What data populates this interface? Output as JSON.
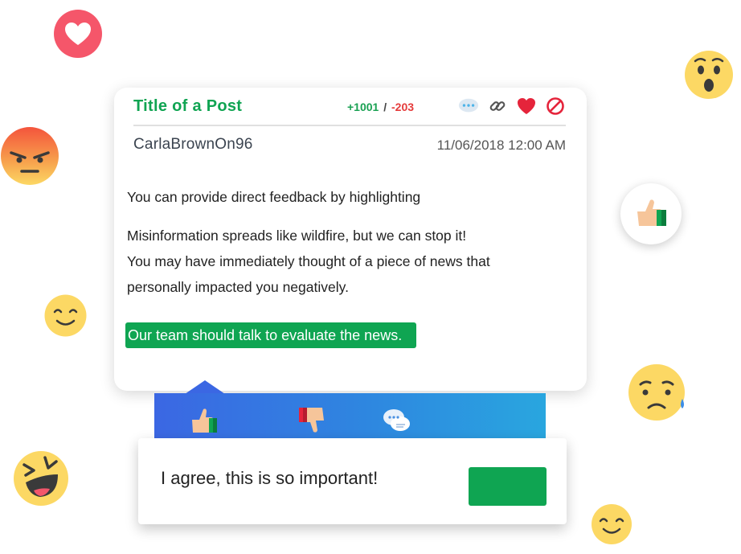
{
  "post": {
    "title": "Title of a Post",
    "votes_up": "+1001",
    "votes_separator": "/",
    "votes_down": "-203",
    "author": "CarlaBrownOn96",
    "timestamp": "11/06/2018 12:00 AM",
    "paragraph_1": "You can provide direct feedback by highlighting",
    "paragraph_2_line_1": "Misinformation spreads like wildfire, but we can stop it!",
    "paragraph_2_line_2": "You may have immediately thought of a piece of news that",
    "paragraph_2_line_3": "personally impacted you negatively.",
    "highlighted_text": "Our team should talk to evaluate the news.",
    "actions": [
      "comment-bubble-icon",
      "link-icon",
      "heart-icon",
      "block-icon"
    ]
  },
  "reaction_bar": {
    "buttons": [
      "thumbs-up-icon",
      "thumbs-down-icon",
      "chat-bubbles-icon"
    ]
  },
  "comment": {
    "value": "I agree, this is so important!",
    "submit_label": ""
  },
  "decorations": {
    "emojis": [
      "heart-emoji",
      "surprised-emoji",
      "angry-emoji",
      "smile-emoji",
      "sad-tear-emoji",
      "laughing-emoji",
      "smile-emoji"
    ],
    "floating_reaction": "thumbs-up-icon"
  },
  "colors": {
    "accent_green": "#0fa552",
    "vote_up": "#1aa153",
    "vote_down": "#e53b3b",
    "bar_gradient_start": "#3b67e3",
    "bar_gradient_end": "#29a6df",
    "heart_red": "#f5566a",
    "emoji_yellow": "#fcd864"
  }
}
